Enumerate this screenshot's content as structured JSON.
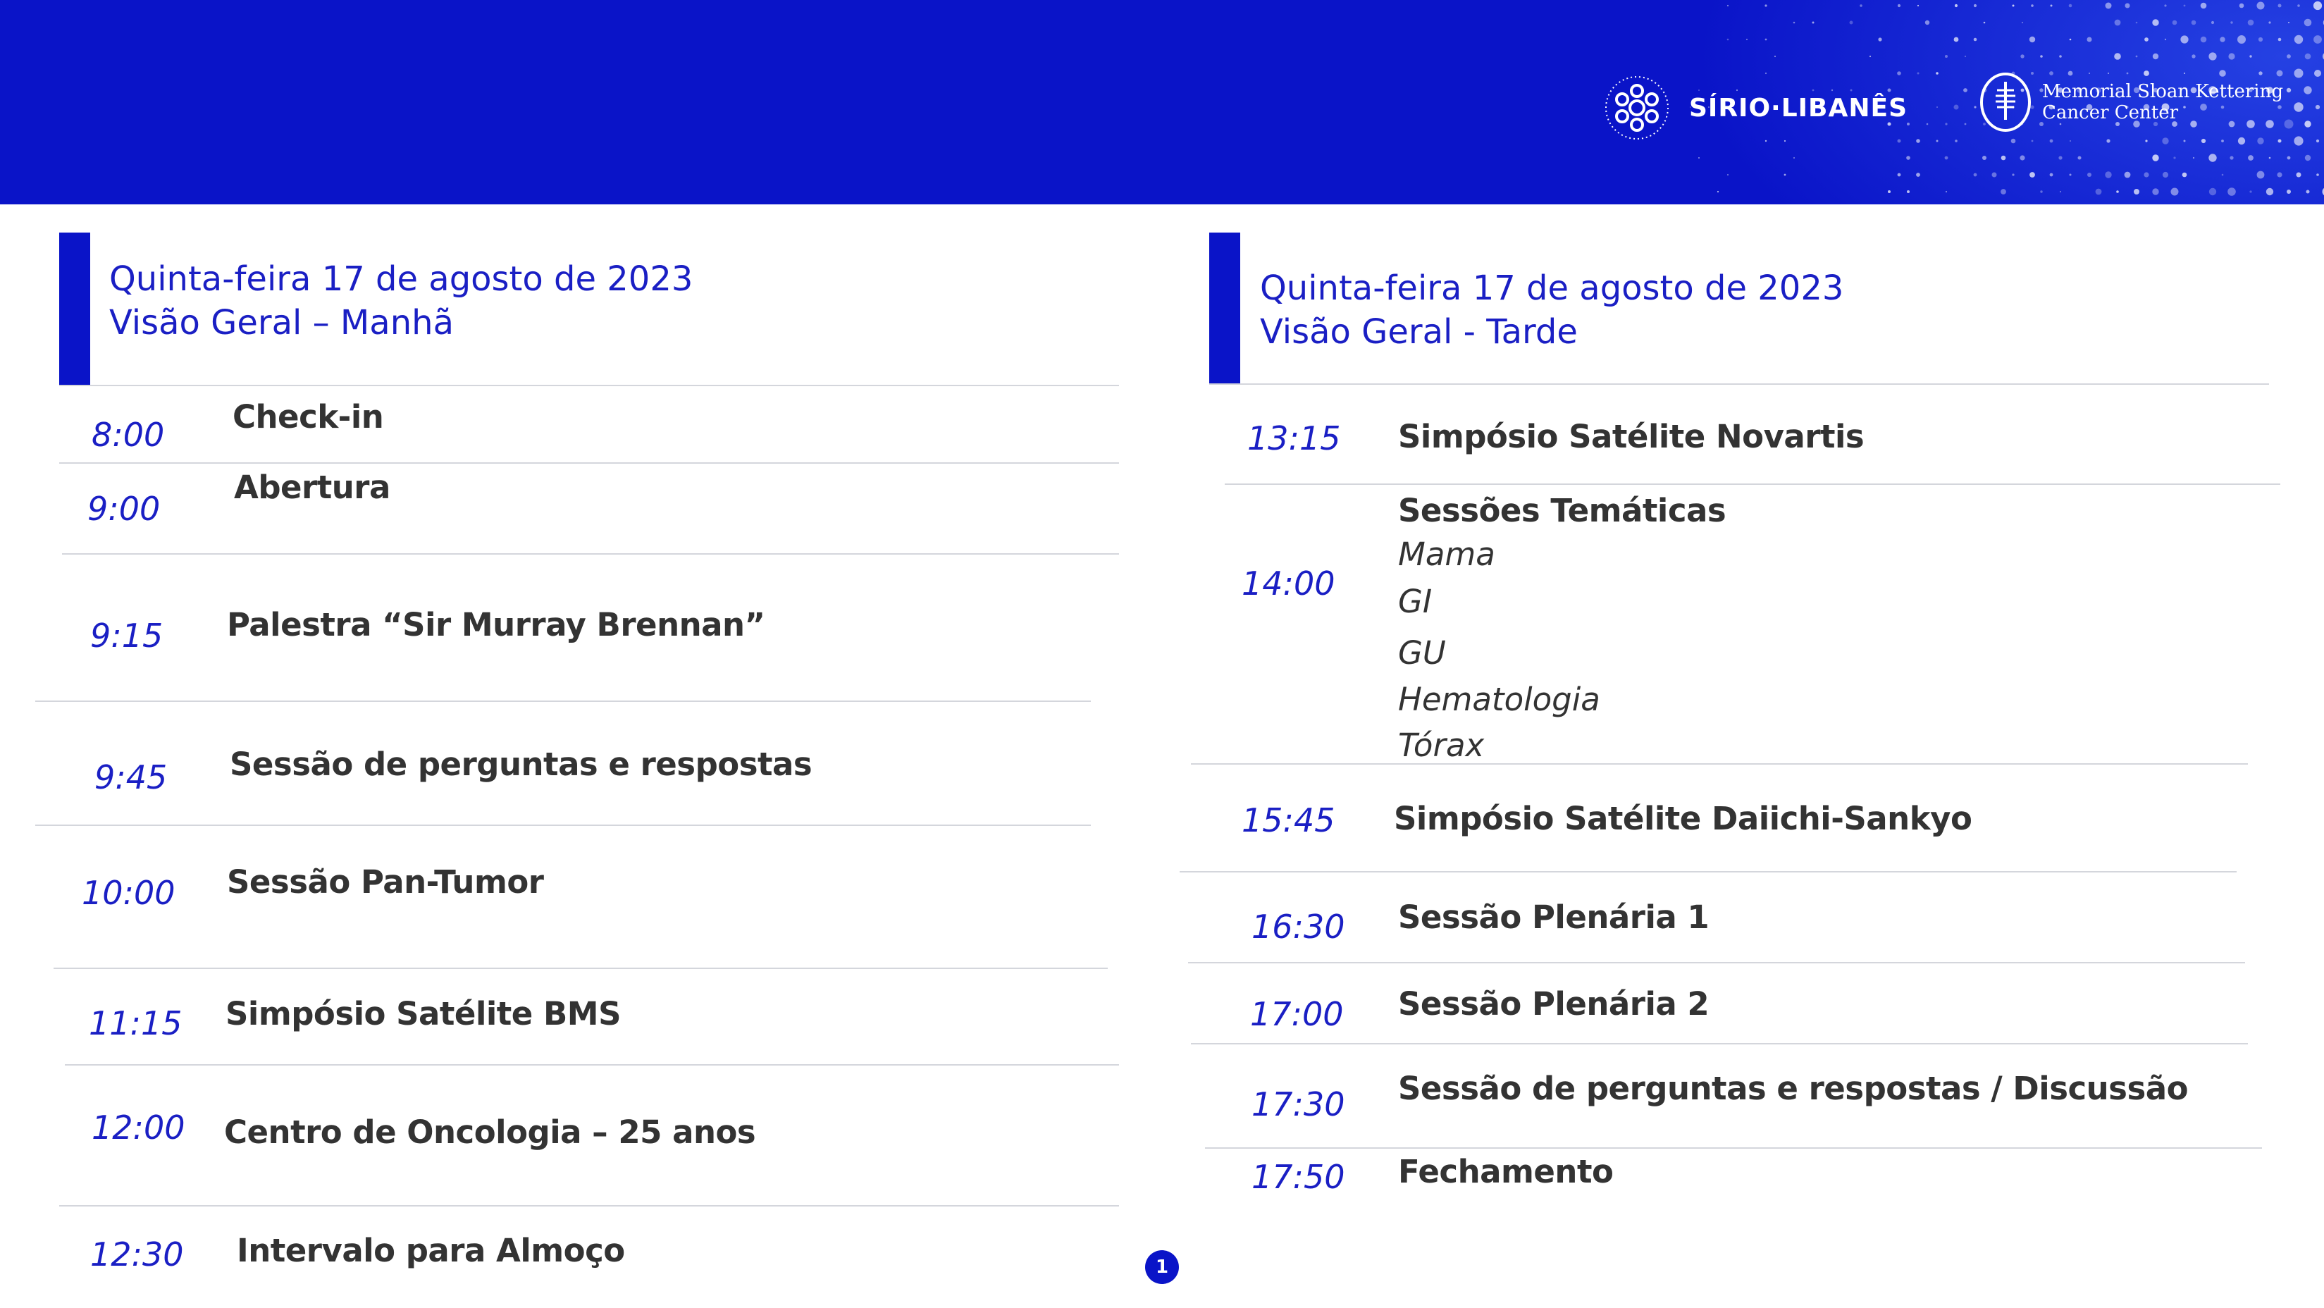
{
  "header": {
    "logo_sirio": "SÍRIO·LIBANÊS",
    "logo_msk_line1": "Memorial Sloan Kettering",
    "logo_msk_line2": "Cancer Center",
    "brand_color": "#0a14c8"
  },
  "morning": {
    "title_line1": "Quinta-feira 17 de agosto de 2023",
    "title_line2": "Visão Geral – Manhã",
    "rows": [
      {
        "time": "8:00",
        "title": "Check-in"
      },
      {
        "time": "9:00",
        "title": "Abertura"
      },
      {
        "time": "9:15",
        "title": "Palestra “Sir Murray Brennan”"
      },
      {
        "time": "9:45",
        "title": "Sessão de perguntas e respostas"
      },
      {
        "time": "10:00",
        "title": "Sessão Pan-Tumor"
      },
      {
        "time": "11:15",
        "title": "Simpósio Satélite BMS"
      },
      {
        "time": "12:00",
        "title": "Centro de Oncologia – 25 anos"
      },
      {
        "time": "12:30",
        "title": "Intervalo para Almoço"
      }
    ]
  },
  "afternoon": {
    "title_line1": "Quinta-feira 17 de agosto de 2023",
    "title_line2": "Visão Geral - Tarde",
    "rows": [
      {
        "time": "13:15",
        "title": "Simpósio Satélite Novartis"
      },
      {
        "time": "14:00",
        "title": "Sessões Temáticas",
        "subitems": [
          "Mama",
          "GI",
          "GU",
          "Hematologia",
          "Tórax"
        ]
      },
      {
        "time": "15:45",
        "title": "Simpósio Satélite Daiichi-Sankyo"
      },
      {
        "time": "16:30",
        "title": "Sessão Plenária 1"
      },
      {
        "time": "17:00",
        "title": "Sessão Plenária 2"
      },
      {
        "time": "17:30",
        "title": "Sessão de perguntas e respostas / Discussão"
      },
      {
        "time": "17:50",
        "title": "Fechamento"
      }
    ]
  },
  "page_number": "1"
}
